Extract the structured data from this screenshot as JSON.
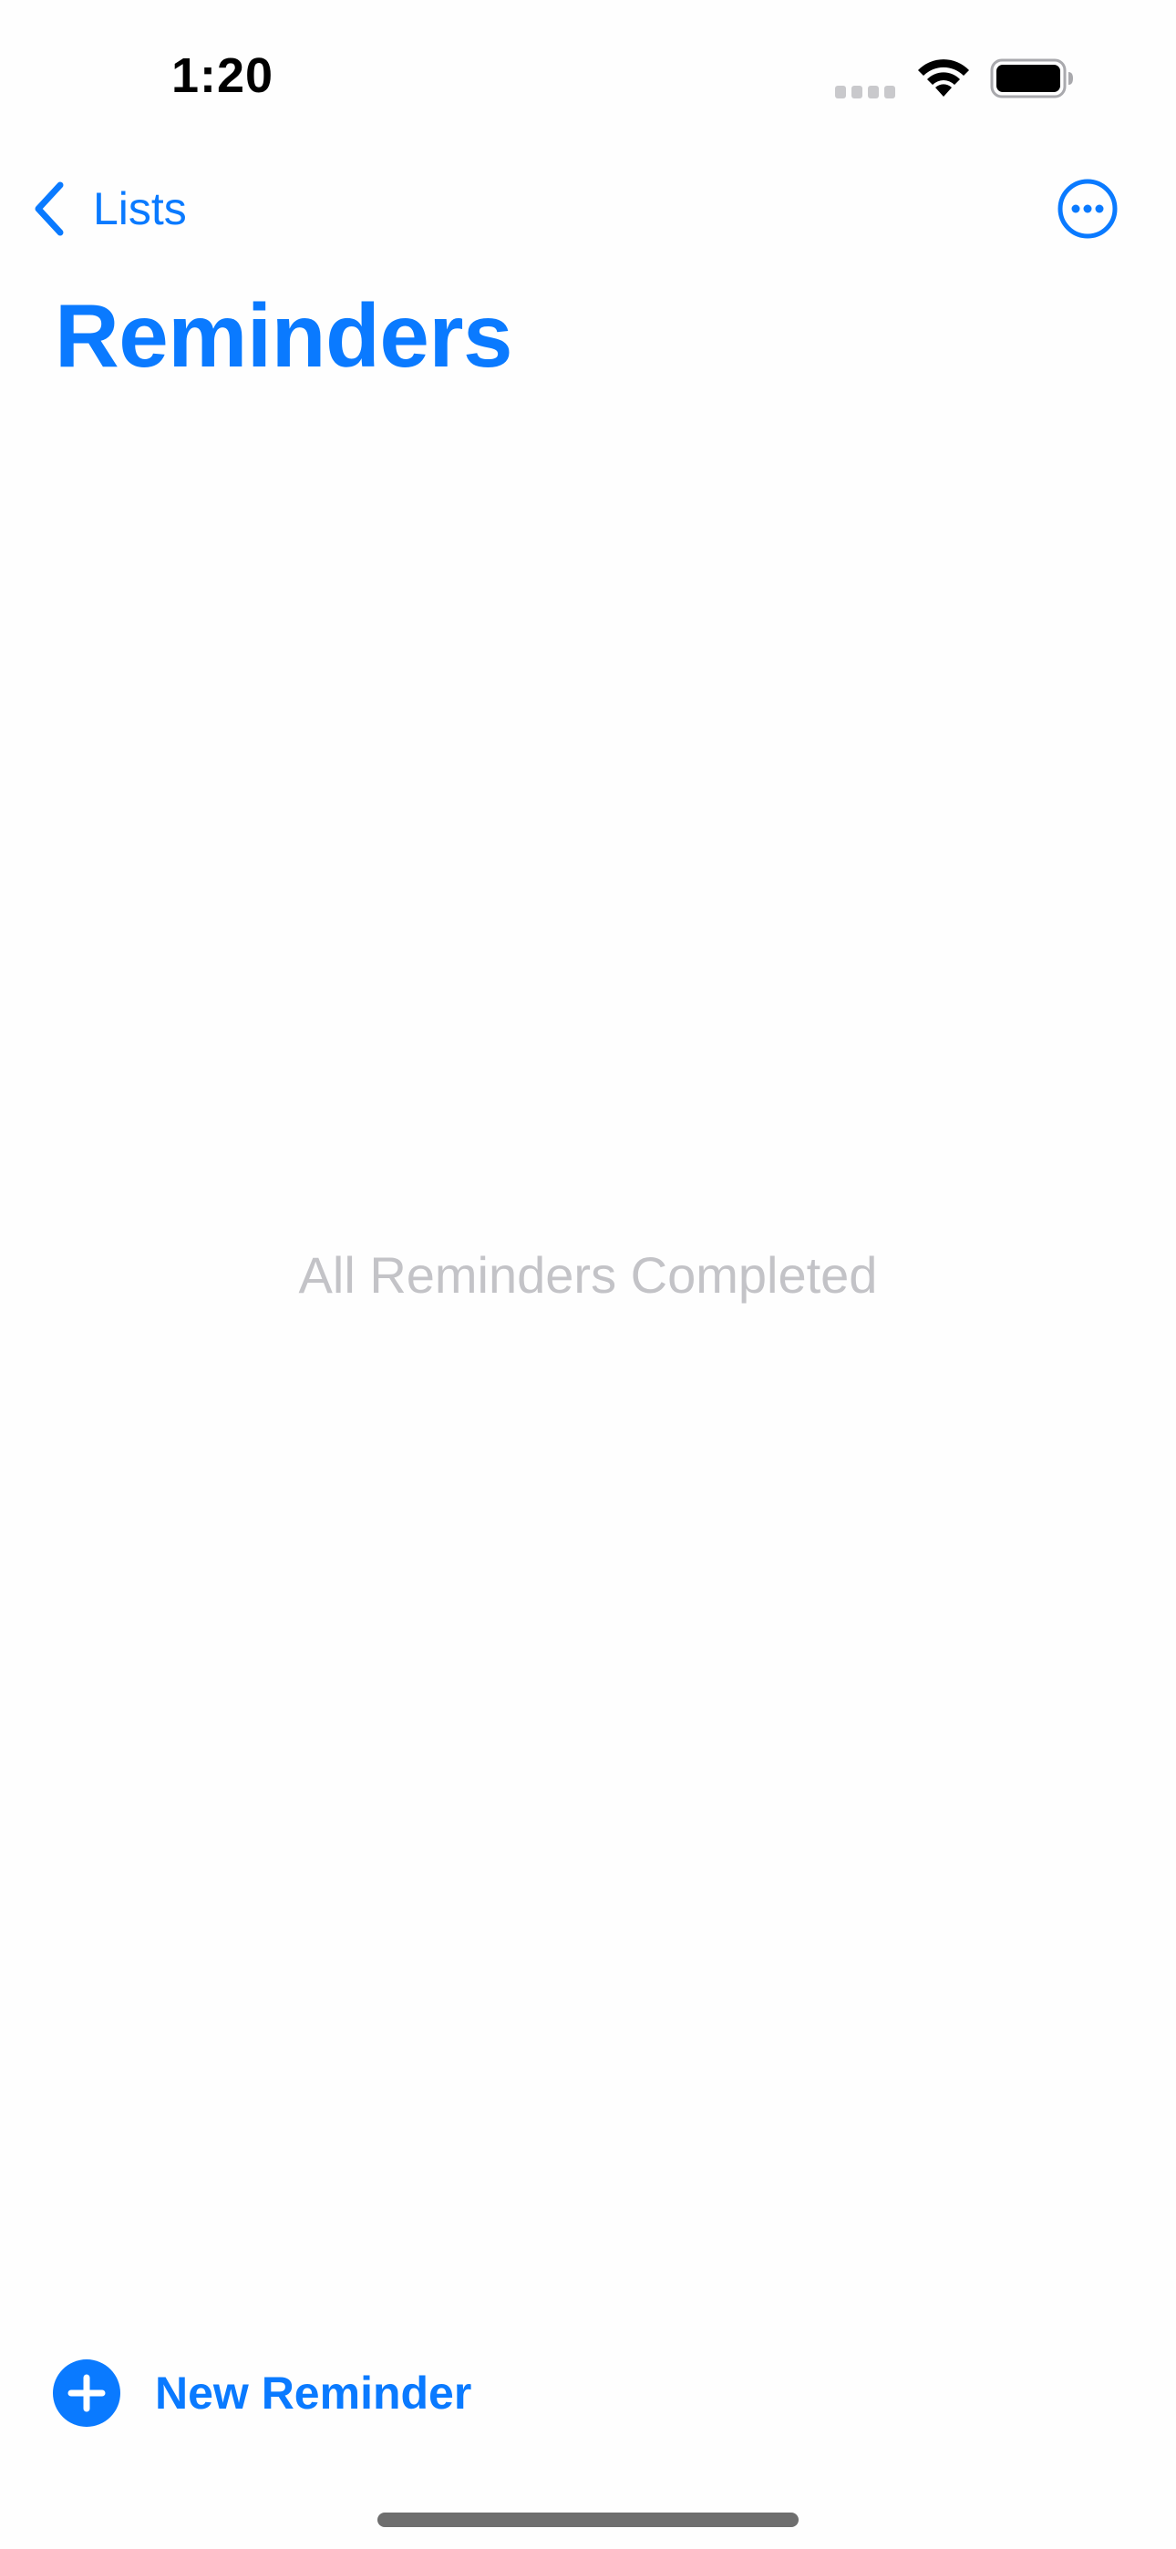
{
  "status_bar": {
    "time": "1:20",
    "icons": [
      "signal-icon",
      "wifi-icon",
      "battery-icon"
    ]
  },
  "nav": {
    "back_label": "Lists",
    "back_icon": "chevron-left-icon",
    "more_icon": "ellipsis-circle-icon"
  },
  "title": "Reminders",
  "empty_state": {
    "message": "All Reminders Completed"
  },
  "new_reminder": {
    "label": "New Reminder",
    "icon": "plus-circle-icon"
  },
  "colors": {
    "accent": "#0a7aff",
    "empty_text": "#c3c3c7",
    "background": "#fefefe"
  }
}
